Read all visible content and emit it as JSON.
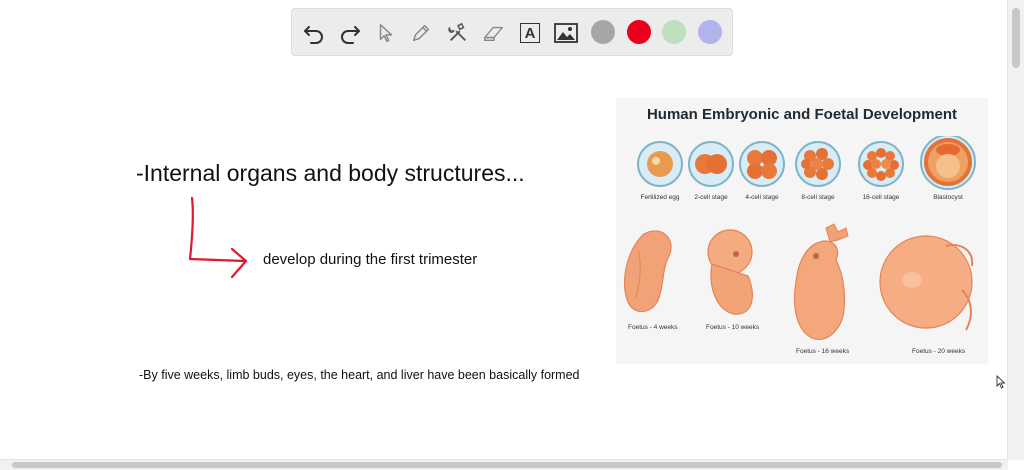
{
  "toolbar": {
    "tools": [
      {
        "name": "undo-icon"
      },
      {
        "name": "redo-icon"
      },
      {
        "name": "pointer-icon"
      },
      {
        "name": "pen-icon"
      },
      {
        "name": "tools-icon"
      },
      {
        "name": "eraser-icon"
      },
      {
        "name": "text-icon",
        "glyph": "A"
      },
      {
        "name": "image-icon"
      }
    ],
    "colors": [
      "#a6a6a6",
      "#e8001c",
      "#bfe0bf",
      "#b3b3ec"
    ]
  },
  "notes": {
    "heading": "-Internal organs and body structures...",
    "arrow_text": "develop during the first trimester",
    "detail": "-By five weeks, limb buds, eyes, the heart, and liver have been basically formed",
    "arrow_color": "#e0182d"
  },
  "figure": {
    "title": "Human Embryonic and Foetal Development",
    "cell_stages": [
      "Fertilized egg",
      "2-cell stage",
      "4-cell stage",
      "8-cell stage",
      "16-cell stage",
      "Blastocyst"
    ],
    "foetus_stages": [
      "Foetus - 4 weeks",
      "Foetus - 10 weeks",
      "Foetus - 16 weeks",
      "Foetus - 20 weeks"
    ]
  }
}
